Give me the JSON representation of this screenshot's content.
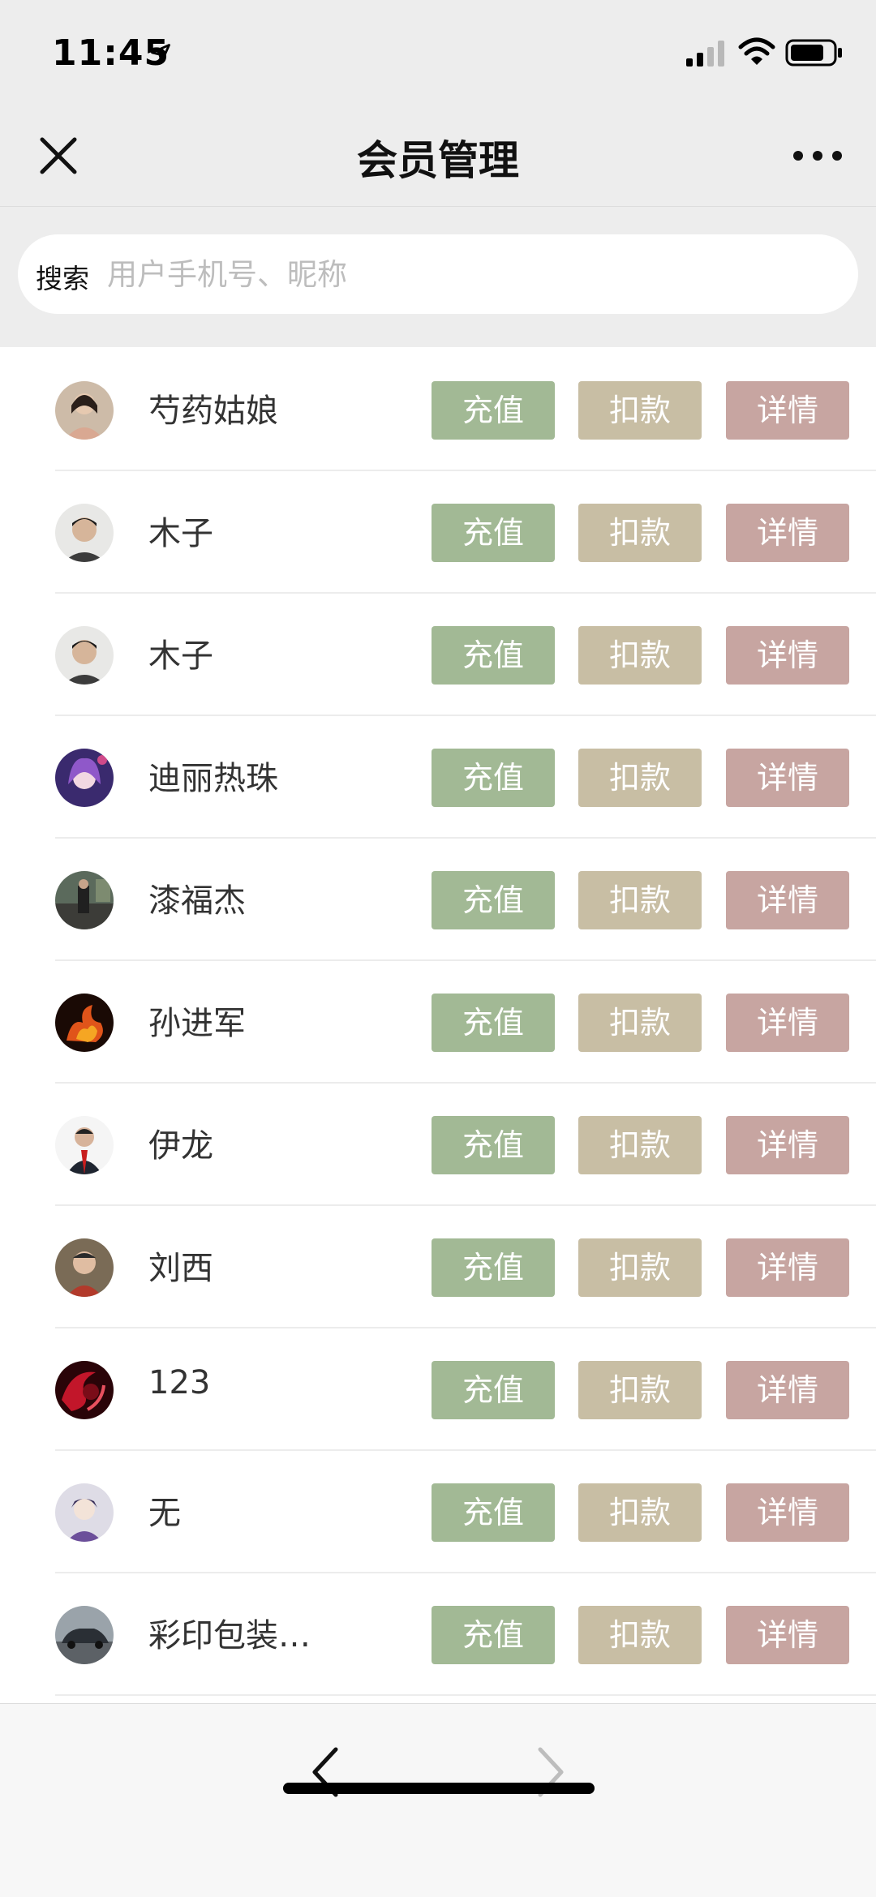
{
  "status_bar": {
    "time": "11:45",
    "icons": [
      "location-arrow-icon",
      "signal-icon",
      "wifi-icon",
      "battery-icon"
    ]
  },
  "nav": {
    "title": "会员管理",
    "close_icon": "close-icon",
    "more_icon": "more-icon"
  },
  "search": {
    "label": "搜索",
    "placeholder": "用户手机号、昵称",
    "value": ""
  },
  "buttons": {
    "recharge": "充值",
    "deduct": "扣款",
    "detail": "详情"
  },
  "members": [
    {
      "name": "芍药姑娘",
      "avatar": "woman-photo"
    },
    {
      "name": "木子",
      "avatar": "man-photo"
    },
    {
      "name": "木子",
      "avatar": "man-photo"
    },
    {
      "name": "迪丽热珠",
      "avatar": "anime-girl"
    },
    {
      "name": "漆福杰",
      "avatar": "street-photo"
    },
    {
      "name": "孙进军",
      "avatar": "fire-photo"
    },
    {
      "name": "伊龙",
      "avatar": "suit-man"
    },
    {
      "name": "刘西",
      "avatar": "child-photo"
    },
    {
      "name": "123",
      "avatar": "red-abstract"
    },
    {
      "name": "无",
      "avatar": "cartoon-boy"
    },
    {
      "name": "彩印包装…",
      "avatar": "car-photo"
    }
  ],
  "toolbar": {
    "back_icon": "back-arrow-icon",
    "forward_icon": "forward-arrow-icon",
    "forward_enabled": false
  },
  "colors": {
    "recharge": "#a2b995",
    "deduct": "#c8bea4",
    "detail": "#c7a5a1",
    "background": "#ededed"
  }
}
